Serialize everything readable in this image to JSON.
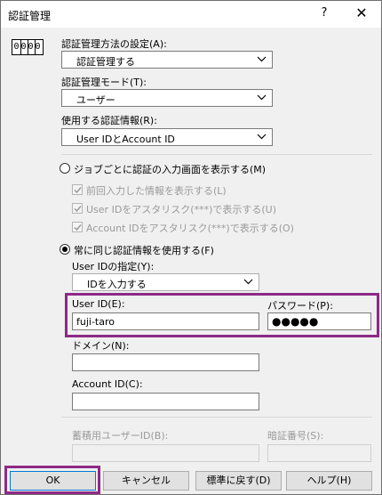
{
  "window": {
    "title": "認証管理",
    "help_label": "?",
    "close_label": "✕"
  },
  "auth_icon": {
    "digits": [
      "0",
      "0",
      "0",
      "0"
    ]
  },
  "auth_method": {
    "label": "認証管理方法の設定(A):",
    "value": "認証管理する"
  },
  "auth_mode": {
    "label": "認証管理モード(T):",
    "value": "ユーザー"
  },
  "auth_info": {
    "label": "使用する認証情報(R):",
    "value": "User IDとAccount ID"
  },
  "per_job": {
    "radio_label": "ジョブごとに認証の入力画面を表示する(M)",
    "selected": false,
    "options": [
      {
        "label": "前回入力した情報を表示する(L)",
        "checked": true
      },
      {
        "label": "User IDをアスタリスク(***)で表示する(U)",
        "checked": true
      },
      {
        "label": "Account IDをアスタリスク(***)で表示する(O)",
        "checked": true
      }
    ]
  },
  "always_same": {
    "radio_label": "常に同じ認証情報を使用する(F)",
    "selected": true,
    "user_id_spec": {
      "label": "User IDの指定(Y):",
      "value": "IDを入力する"
    },
    "user_id": {
      "label": "User ID(E):",
      "value": "fuji-taro"
    },
    "password": {
      "label": "パスワード(P):",
      "value": "●●●●●"
    },
    "domain": {
      "label": "ドメイン(N):",
      "value": ""
    },
    "account_id": {
      "label": "Account ID(C):",
      "value": ""
    }
  },
  "storage": {
    "user_id_label": "蓄積用ユーザーID(B):",
    "pin_label": "暗証番号(S):"
  },
  "buttons": {
    "ok": "OK",
    "cancel": "キャンセル",
    "default": "標準に戻す(D)",
    "help": "ヘルプ(H)"
  },
  "colors": {
    "highlight": "#8e2a86",
    "focus_border": "#0078d7"
  }
}
